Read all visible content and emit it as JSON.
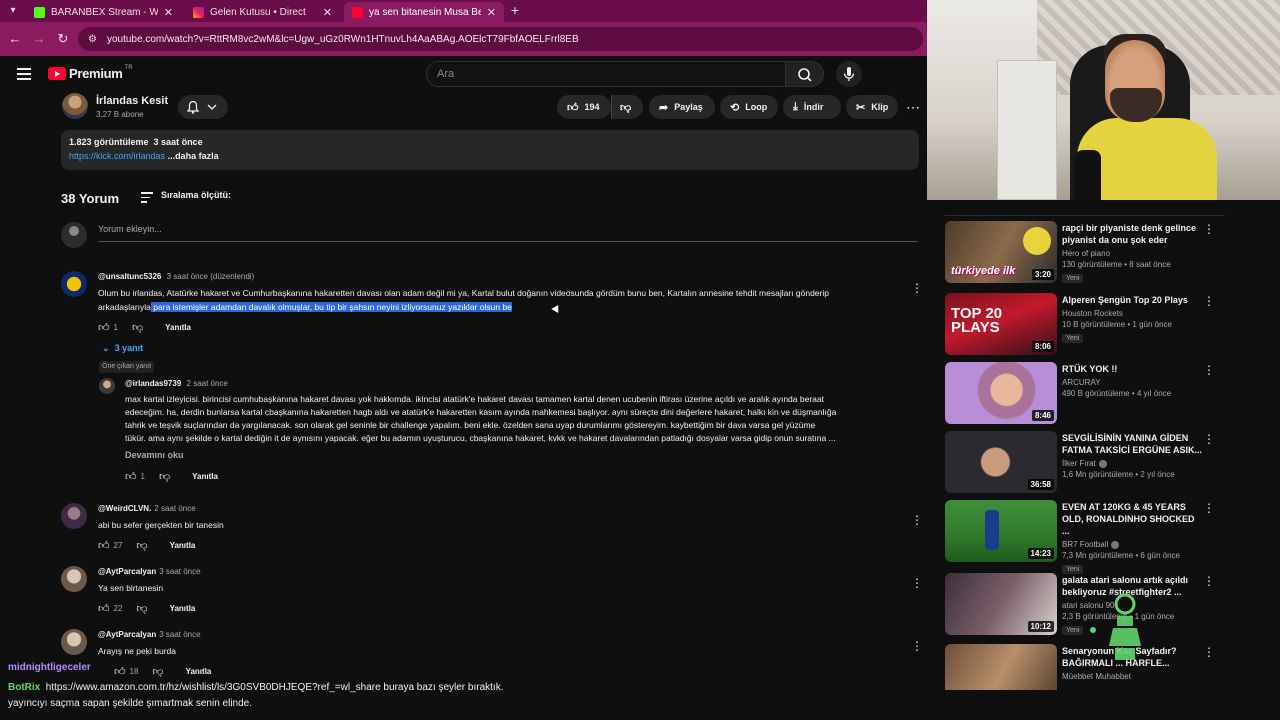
{
  "colors": {
    "yt_red": "#ff0033",
    "link_blue": "#3ea6ff",
    "chrome_bg": "#8a1b60",
    "tab_strip": "#6b0d4a",
    "highlight": "#2f67d6",
    "chat_green": "#60d36b",
    "chat_violet": "#b38bff"
  },
  "browser": {
    "tabs": [
      {
        "title": "BARANBEX Stream - Watch Live",
        "icon": "kick-icon",
        "active": false
      },
      {
        "title": "Gelen Kutusu • Direct",
        "icon": "instagram-icon",
        "active": false
      },
      {
        "title": "ya sen bitanesin Musa Bey hakkı",
        "icon": "youtube-icon",
        "active": true
      }
    ],
    "url": "youtube.com/watch?v=RttRM8vc2wM&lc=Ugw_uGz0RWn1HTnuvLh4AaABAg.AOElcT79FbfAOELFrrl8EB"
  },
  "header": {
    "logo_text": "Premium",
    "region": "TR",
    "search_placeholder": "Ara"
  },
  "channel": {
    "name": "İrlandas Kesit",
    "subs": "3,27 B abone"
  },
  "actions": {
    "likes": "194",
    "share": "Paylaş",
    "loop": "Loop",
    "download": "İndir",
    "clip": "Klip"
  },
  "description": {
    "views": "1.823 görüntüleme",
    "time": "3 saat önce",
    "link": "https://kick.com/irlandas",
    "more": "...daha fazla"
  },
  "comments_section": {
    "count_label": "38 Yorum",
    "sort_label": "Sıralama ölçütü:",
    "add_placeholder": "Yorum ekleyin..."
  },
  "comments": [
    {
      "author": "@unsaltunc5326",
      "time": "3 saat önce (düzenlendi)",
      "text_line1": "Olum bu irlandas, Atatürke hakaret ve Cumhurbaşkanına hakaretten davası olan adam değil mi ya, Kartal bulut doğanın videosunda gördüm bunu ben, Kartalın annesine tehdit mesajları gönderip",
      "text_line2_plain": "arkadaşlarıyla",
      "text_line2_selected": " para istemişler adamdan davalık olmuşlar, bu tip bir şahsın neyini izliyorsunuz yazıklar olsun be",
      "likes": "1",
      "reply_label": "Yanıtla",
      "replies_label": "3 yanıt"
    }
  ],
  "reply": {
    "badge": "Öne çıkan yanıt",
    "author": "@irlandas9739",
    "time": "2 saat önce",
    "lines": [
      "max kartal izleyicisi. birincisi cumhubaşkanına hakaret davası yok hakkımda. ikincisi atatürk'e hakaret davası tamamen kartal denen ucubenin iftirası üzerine açıldı ve aralık ayında beraat",
      "edeceğim. ha, derdin bunlarsa kartal cbaşkanına hakaretten hagb aldı ve atatürk'e hakaretten kasım ayında mahkemesi başlıyor. aynı süreçte dini değerlere hakaret, halkı kin ve düşmanlığa",
      "tahrik ve teşvik suçlarından da yargılanacak.  son olarak gel seninle bir challenge yapalım. beni ekle. özelden sana uyap durumlarımı göstereyim. kaybettiğim bir dava varsa gel yüzüme",
      "tükür. ama aynı şekilde o kartal dediğin it de aynısını yapacak. eğer bu adamın uyuşturucu, cbaşkanına hakaret, kvkk ve hakaret davalarından patladığı dosyalar varsa gidip onun suratına ..."
    ],
    "read_more": "Devamını oku",
    "likes": "1",
    "reply_label": "Yanıtla"
  },
  "more_comments": [
    {
      "author": "@WeirdCLVN.",
      "time": "2 saat önce",
      "text": "abi bu sefer gerçekten bir tanesin",
      "likes": "27",
      "reply_label": "Yanıtla"
    },
    {
      "author": "@AytParcalyan",
      "time": "3 saat önce",
      "text": "Ya sen birtanesin",
      "likes": "22",
      "reply_label": "Yanıtla"
    },
    {
      "author": "@AytParcalyan",
      "time": "3 saat önce",
      "text": "Arayış ne peki burda",
      "likes": "18",
      "reply_label": "Yanıtla"
    }
  ],
  "recommendations": [
    {
      "title": "rapçi bir piyaniste denk gelince piyanist da onu şok eder",
      "channel": "Hero of piano",
      "stats": "130 görüntüleme • 8 saat önce",
      "badge": "Yeni",
      "duration": "3:20",
      "thumb_text": "türkiyede ilk"
    },
    {
      "title": "Alperen Şengün Top 20 Plays",
      "channel": "Houston Rockets",
      "stats": "10 B görüntüleme • 1 gün önce",
      "badge": "Yeni",
      "duration": "8:06",
      "thumb_text": "TOP 20 PLAYS"
    },
    {
      "title": "RTÜK YOK !!",
      "channel": "ARCURAY",
      "stats": "490 B görüntüleme • 4 yıl önce",
      "badge": "",
      "duration": "8:46",
      "thumb_text": ""
    },
    {
      "title": "SEVGİLİSİNİN YANINA GİDEN FATMA TAKSİCİ ERGÜNE ASIK...",
      "channel": "İlker Fırat",
      "stats": "1,6 Mn görüntüleme • 2 yıl önce",
      "badge": "",
      "duration": "36:58",
      "thumb_text": ""
    },
    {
      "title": "EVEN AT 120KG & 45 YEARS OLD, RONALDINHO SHOCKED ...",
      "channel": "BR7 Football",
      "stats": "7,3 Mn görüntüleme • 6 gün önce",
      "badge": "Yeni",
      "duration": "14:23",
      "thumb_text": ""
    },
    {
      "title": "galata atari salonu artık açıldı bekliyoruz #streetfighter2 ...",
      "channel": "atari salonu 90",
      "stats": "2,3 B görüntüleme • 1 gün önce",
      "badge": "Yeni",
      "duration": "10:12",
      "thumb_text": ""
    },
    {
      "title": "Senaryonun Kaç Sayfadır? BAĞIRMALI ... HARFLE...",
      "channel": "Müebbet Muhabbet",
      "stats": "",
      "badge": "",
      "duration": "",
      "thumb_text": ""
    }
  ],
  "chat": [
    {
      "user": "midnightligeceler",
      "text": ""
    },
    {
      "user": "BotRix",
      "text": "https://www.amazon.com.tr/hz/wishlist/ls/3G0SVB0DHJEQE?ref_=wl_share buraya bazı şeyler bıraktık."
    },
    {
      "user": "",
      "text": "yayıncıyı saçma sapan şekilde şımartmak senin elinde."
    }
  ]
}
